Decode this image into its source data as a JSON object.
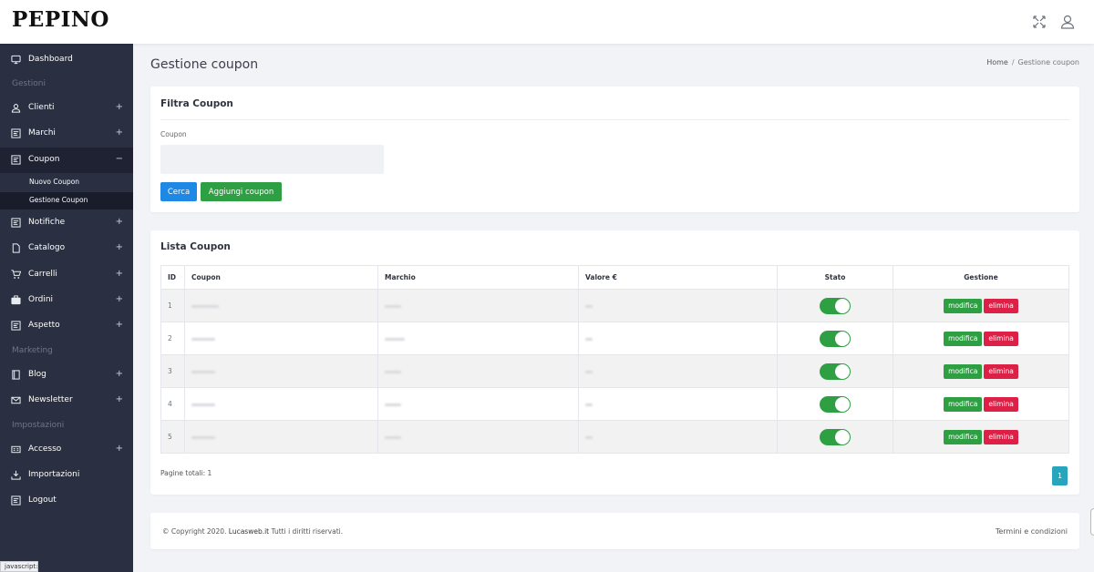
{
  "app": {
    "logo": "PEPINO"
  },
  "topbar": {
    "fullscreen_icon": "fullscreen-icon",
    "user_icon": "user-icon"
  },
  "sidebar": {
    "dashboard": "Dashboard",
    "section_gestioni": "Gestioni",
    "clienti": "Clienti",
    "marchi": "Marchi",
    "coupon": "Coupon",
    "nuovo_coupon": "Nuovo Coupon",
    "gestione_coupon": "Gestione Coupon",
    "notifiche": "Notifiche",
    "catalogo": "Catalogo",
    "carrelli": "Carrelli",
    "ordini": "Ordini",
    "aspetto": "Aspetto",
    "section_marketing": "Marketing",
    "blog": "Blog",
    "newsletter": "Newsletter",
    "section_impostazioni": "Impostazioni",
    "accesso": "Accesso",
    "importazioni": "Importazioni",
    "logout": "Logout",
    "expand": "+",
    "collapse": "−"
  },
  "status_bar": "javascript:",
  "page": {
    "title": "Gestione coupon",
    "breadcrumb_home": "Home",
    "breadcrumb_sep": "/",
    "breadcrumb_current": "Gestione coupon"
  },
  "filter": {
    "title": "Filtra Coupon",
    "coupon_label": "Coupon",
    "coupon_value": "",
    "search_button": "Cerca",
    "add_button": "Aggiungi coupon"
  },
  "list": {
    "title": "Lista Coupon",
    "columns": {
      "id": "ID",
      "coupon": "Coupon",
      "marchio": "Marchio",
      "valore": "Valore €",
      "stato": "Stato",
      "gestione": "Gestione"
    },
    "rows": [
      {
        "id": "1",
        "stato_on": true
      },
      {
        "id": "2",
        "stato_on": true
      },
      {
        "id": "3",
        "stato_on": true
      },
      {
        "id": "4",
        "stato_on": true
      },
      {
        "id": "5",
        "stato_on": true
      }
    ],
    "edit_label": "modifica",
    "delete_label": "elimina",
    "pages_total": "Pagine totali: 1",
    "current_page": "1"
  },
  "footer": {
    "copyright_prefix": "© Copyright 2020.",
    "copyright_brand": "Lucasweb.it",
    "copyright_suffix": "Tutti i diritti riservati.",
    "terms": "Termini e condizioni"
  },
  "colors": {
    "sidebar_bg": "#2a3042",
    "primary": "#1e88e5",
    "success": "#2ea043",
    "danger": "#dc2046",
    "info": "#26a5bd"
  }
}
